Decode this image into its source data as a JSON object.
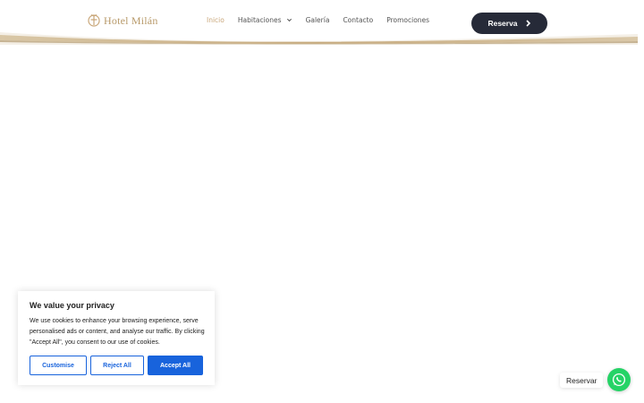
{
  "header": {
    "logo_text": "Hotel Milán",
    "nav": [
      {
        "label": "Inicio",
        "active": true
      },
      {
        "label": "Habitaciones",
        "has_dropdown": true
      },
      {
        "label": "Galería"
      },
      {
        "label": "Contacto"
      },
      {
        "label": "Promociones"
      }
    ],
    "cta_label": "Reserva"
  },
  "cookie_banner": {
    "title": "We value your privacy",
    "text": "We use cookies to enhance your browsing experience, serve personalised ads or content, and analyse our traffic. By clicking \"Accept All\", you consent to our use of cookies.",
    "customise_label": "Customise",
    "reject_label": "Reject All",
    "accept_label": "Accept All"
  },
  "whatsapp": {
    "label": "Reservar",
    "icon": "whatsapp-icon"
  },
  "colors": {
    "accent_gold": "#c9a77a",
    "cta_dark": "#262a38",
    "cookie_blue": "#1863dc",
    "whatsapp_green": "#25d366"
  }
}
